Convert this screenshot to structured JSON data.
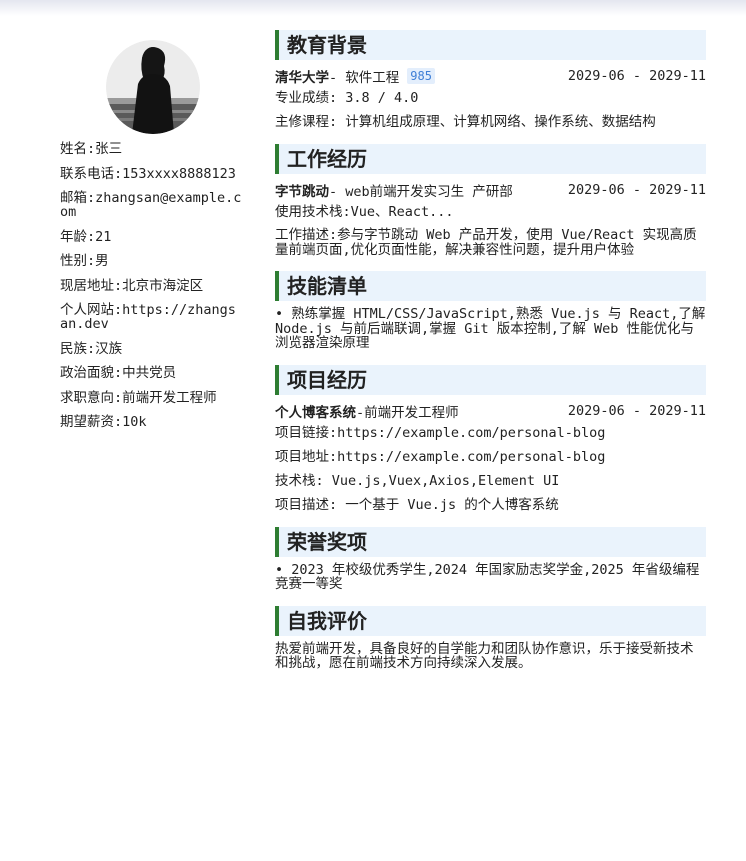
{
  "personal": {
    "name": "姓名:张三",
    "phone": "联系电话:153xxxx8888123",
    "email": "邮箱:zhangsan@example.com",
    "age": "年龄:21",
    "gender": "性别:男",
    "address": "现居地址:北京市海淀区",
    "website": "个人网站:https://zhangsan.dev",
    "ethnicity": "民族:汉族",
    "political": "政治面貌:中共党员",
    "job_intent": "求职意向:前端开发工程师",
    "salary": "期望薪资:10k"
  },
  "education": {
    "title": "教育背景",
    "school": "清华大学",
    "major": " - 软件工程",
    "badge": "985",
    "date": "2029-06 - 2029-11",
    "score": "专业成绩: 3.8 / 4.0",
    "courses": "主修课程: 计算机组成原理、计算机网络、操作系统、数据结构"
  },
  "work": {
    "title": "工作经历",
    "company": "字节跳动",
    "role": " - web前端开发实习生 产研部",
    "date": "2029-06 - 2029-11",
    "tech": "使用技术栈:Vue、React...",
    "desc": "工作描述:参与字节跳动 Web 产品开发，使用 Vue/React 实现高质量前端页面,优化页面性能，解决兼容性问题，提升用户体验"
  },
  "skills": {
    "title": "技能清单",
    "content": "• 熟练掌握 HTML/CSS/JavaScript,熟悉 Vue.js 与 React,了解 Node.js 与前后端联调,掌握 Git 版本控制,了解 Web 性能优化与浏览器渲染原理"
  },
  "projects": {
    "title": "项目经历",
    "name": "个人博客系统",
    "role": "-前端开发工程师",
    "date": "2029-06 - 2029-11",
    "link": "项目链接:https://example.com/personal-blog",
    "address": "项目地址:https://example.com/personal-blog",
    "tech": "技术栈: Vue.js,Vuex,Axios,Element UI",
    "desc": "项目描述: 一个基于 Vue.js 的个人博客系统"
  },
  "honors": {
    "title": "荣誉奖项",
    "content": "• 2023 年校级优秀学生,2024 年国家励志奖学金,2025 年省级编程竞赛一等奖"
  },
  "self_eval": {
    "title": "自我评价",
    "content": "热爱前端开发，具备良好的自学能力和团队协作意识，乐于接受新技术和挑战，愿在前端技术方向持续深入发展。"
  }
}
